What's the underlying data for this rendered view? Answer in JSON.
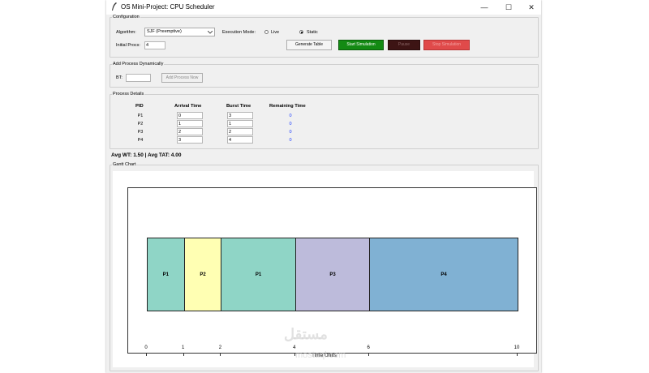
{
  "window": {
    "title": "OS Mini-Project: CPU Scheduler",
    "min": "—",
    "max": "☐",
    "close": "✕"
  },
  "config": {
    "legend": "Configuration",
    "algorithm_label": "Algorithm:",
    "algorithm_value": "SJF (Preemptive)",
    "mode_label": "Execution Mode:",
    "mode_live": "Live",
    "mode_static": "Static",
    "mode_selected": "Static",
    "initial_label": "Initial Procs:",
    "initial_value": "4",
    "generate_btn": "Generate Table",
    "start_btn": "Start Simulation",
    "pause_btn": "Pause",
    "stop_btn": "Stop Simulation"
  },
  "dynamic": {
    "legend": "Add Process Dynamically",
    "bt_label": "BT:",
    "bt_value": "",
    "add_btn": "Add Process Now"
  },
  "details": {
    "legend": "Process Details",
    "headers": [
      "PID",
      "Arrival Time",
      "Burst Time",
      "Remaining Time"
    ],
    "rows": [
      {
        "pid": "P1",
        "arrival": "0",
        "burst": "3",
        "remaining": "0"
      },
      {
        "pid": "P2",
        "arrival": "1",
        "burst": "1",
        "remaining": "0"
      },
      {
        "pid": "P3",
        "arrival": "2",
        "burst": "2",
        "remaining": "0"
      },
      {
        "pid": "P4",
        "arrival": "3",
        "burst": "4",
        "remaining": "0"
      }
    ]
  },
  "stats": "Avg WT: 1.50 | Avg TAT: 4.00",
  "gantt": {
    "legend": "Gantt Chart"
  },
  "colors": {
    "start": "#138a13",
    "pause": "#3d1414",
    "stop": "#e04a4a",
    "P1": "#8fd5c6",
    "P2": "#ffffb3",
    "P3": "#bdbbdb",
    "P4": "#80b1d3"
  },
  "chart_data": {
    "type": "bar",
    "xlabel": "Time Units",
    "xlim": [
      0,
      10
    ],
    "xticks": [
      0,
      1,
      2,
      4,
      6,
      10
    ],
    "segments": [
      {
        "label": "P1",
        "start": 0,
        "end": 1,
        "color": "#8fd5c6"
      },
      {
        "label": "P2",
        "start": 1,
        "end": 2,
        "color": "#ffffb3"
      },
      {
        "label": "P1",
        "start": 2,
        "end": 4,
        "color": "#8fd5c6"
      },
      {
        "label": "P3",
        "start": 4,
        "end": 6,
        "color": "#bdbbdb"
      },
      {
        "label": "P4",
        "start": 6,
        "end": 10,
        "color": "#80b1d3"
      }
    ]
  },
  "watermark": {
    "arabic": "مستقل",
    "latin": "mostaql.com"
  }
}
